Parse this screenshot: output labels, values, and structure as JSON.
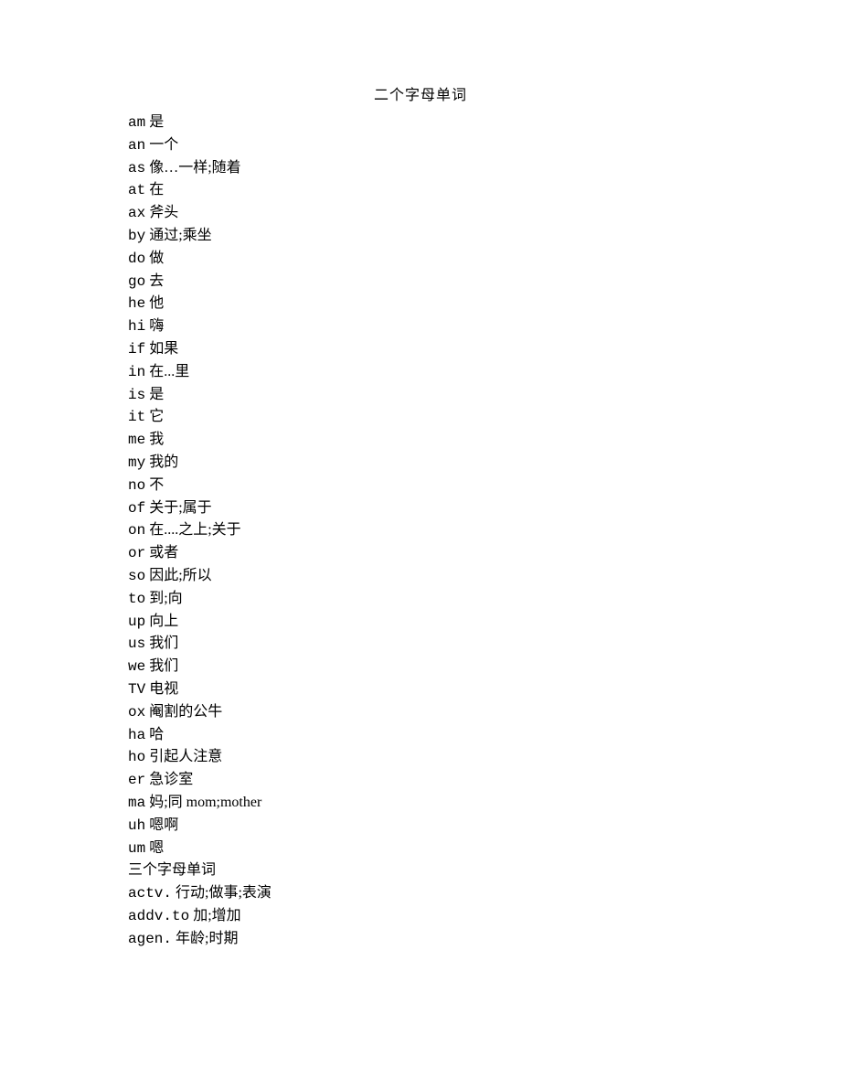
{
  "title": "二个字母单词",
  "entries": [
    {
      "word": "am",
      "def": "是"
    },
    {
      "word": "an",
      "def": "一个"
    },
    {
      "word": "as",
      "def": "像…一样;随着"
    },
    {
      "word": "at",
      "def": "在"
    },
    {
      "word": "ax",
      "def": "斧头"
    },
    {
      "word": "by",
      "def": "通过;乘坐"
    },
    {
      "word": "do",
      "def": "做"
    },
    {
      "word": "go",
      "def": "去"
    },
    {
      "word": "he",
      "def": "他"
    },
    {
      "word": "hi",
      "def": "嗨"
    },
    {
      "word": "if",
      "def": "如果"
    },
    {
      "word": "in",
      "def": "在...里"
    },
    {
      "word": "is",
      "def": "是"
    },
    {
      "word": "it",
      "def": "它"
    },
    {
      "word": "me",
      "def": "我"
    },
    {
      "word": "my",
      "def": "我的"
    },
    {
      "word": "no",
      "def": "不"
    },
    {
      "word": "of",
      "def": "关于;属于"
    },
    {
      "word": "on",
      "def": "在....之上;关于"
    },
    {
      "word": "or",
      "def": "或者"
    },
    {
      "word": "so",
      "def": "因此;所以"
    },
    {
      "word": "to",
      "def": "到;向"
    },
    {
      "word": "up",
      "def": "向上"
    },
    {
      "word": "us",
      "def": "我们"
    },
    {
      "word": "we",
      "def": "我们"
    },
    {
      "word": "TV",
      "def": "电视"
    },
    {
      "word": "ox",
      "def": "阉割的公牛"
    },
    {
      "word": "ha",
      "def": "哈"
    },
    {
      "word": "ho",
      "def": "引起人注意"
    },
    {
      "word": "er",
      "def": "急诊室"
    },
    {
      "word": "ma",
      "def": "妈;同 mom;mother"
    },
    {
      "word": "uh",
      "def": "嗯啊"
    },
    {
      "word": "um",
      "def": "嗯"
    },
    {
      "word": "三个字母单词",
      "def": ""
    },
    {
      "word": "actv.",
      "def": "行动;做事;表演"
    },
    {
      "word": "addv.to",
      "def": "加;增加"
    },
    {
      "word": "agen.",
      "def": "年龄;时期"
    }
  ]
}
